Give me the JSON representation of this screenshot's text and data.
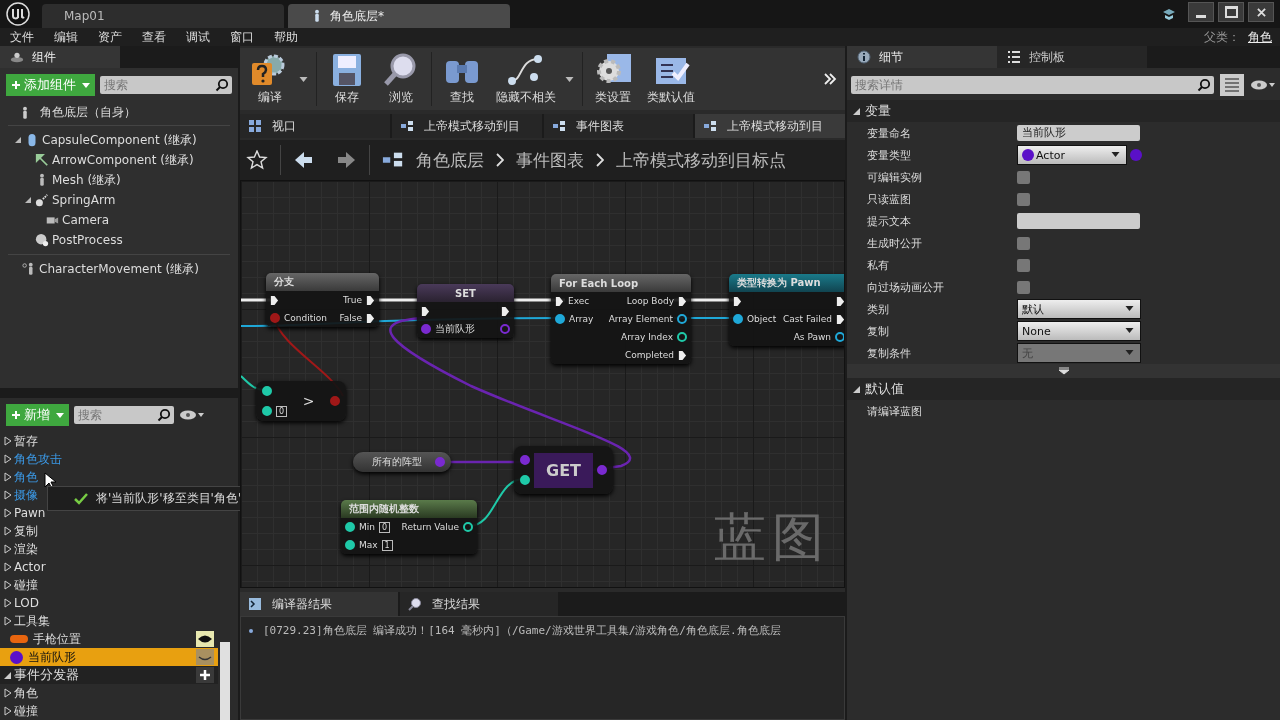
{
  "title_bar": {
    "tabs": [
      {
        "label": "Map01",
        "selected": false
      },
      {
        "label": "角色底层*",
        "selected": true
      }
    ],
    "parent_label": "父类：",
    "parent_class": "角色"
  },
  "menu": [
    "文件",
    "编辑",
    "资产",
    "查看",
    "调试",
    "窗口",
    "帮助"
  ],
  "components": {
    "tab": "组件",
    "add_button": "添加组件",
    "search": {
      "placeholder": "搜索"
    },
    "self": "角色底层（自身）",
    "tree": [
      {
        "label": "CapsuleComponent (继承)",
        "kind": "capsule",
        "expanded": true,
        "children": [
          {
            "label": "ArrowComponent (继承)",
            "kind": "arrow"
          },
          {
            "label": "Mesh (继承)",
            "kind": "mesh"
          },
          {
            "label": "SpringArm",
            "kind": "springarm",
            "expanded": true,
            "children": [
              {
                "label": "Camera",
                "kind": "camera"
              }
            ]
          },
          {
            "label": "PostProcess",
            "kind": "postprocess"
          }
        ]
      }
    ],
    "movement": "CharacterMovement (继承)"
  },
  "my_blueprint": {
    "add_button": "新增",
    "search": {
      "placeholder": "搜索"
    },
    "items": [
      {
        "kind": "category",
        "label": "暂存",
        "highlighted": false
      },
      {
        "kind": "category",
        "label": "角色攻击",
        "highlighted": true
      },
      {
        "kind": "category",
        "label": "角色",
        "highlighted": true
      },
      {
        "kind": "category",
        "label": "摄像",
        "highlighted": true
      },
      {
        "kind": "category",
        "label": "Pawn",
        "highlighted": false
      },
      {
        "kind": "category",
        "label": "复制",
        "highlighted": false
      },
      {
        "kind": "category",
        "label": "渲染",
        "highlighted": false
      },
      {
        "kind": "category",
        "label": "Actor",
        "highlighted": false
      },
      {
        "kind": "category",
        "label": "碰撞",
        "highlighted": false
      },
      {
        "kind": "category",
        "label": "LOD",
        "highlighted": false
      },
      {
        "kind": "category",
        "label": "工具集",
        "highlighted": false
      },
      {
        "kind": "variable",
        "label": "手枪位置",
        "color": "#e8650f",
        "selected": false,
        "public": true
      },
      {
        "kind": "variable",
        "label": "当前队形",
        "color": "#5a10c8",
        "selected": true,
        "public": false
      },
      {
        "kind": "section",
        "label": "事件分发器"
      },
      {
        "kind": "category",
        "label": "角色",
        "highlighted": false
      },
      {
        "kind": "category",
        "label": "碰撞",
        "highlighted": false
      }
    ],
    "tooltip": "将'当前队形'移至类目'角色'"
  },
  "toolbar": [
    {
      "label": "编译",
      "kind": "compile",
      "dropdown": true
    },
    {
      "label": "保存",
      "kind": "save",
      "dropdown": false
    },
    {
      "label": "浏览",
      "kind": "browse",
      "dropdown": false
    },
    {
      "label": "查找",
      "kind": "find",
      "dropdown": false
    },
    {
      "label": "隐藏不相关",
      "kind": "hide",
      "dropdown": true
    },
    {
      "label": "类设置",
      "kind": "settings",
      "dropdown": false
    },
    {
      "label": "类默认值",
      "kind": "defaults",
      "dropdown": false
    }
  ],
  "doc_tabs": [
    {
      "label": "视口",
      "kind": "viewport",
      "selected": false
    },
    {
      "label": "上帝模式移动到目",
      "kind": "graph",
      "selected": false
    },
    {
      "label": "事件图表",
      "kind": "graph",
      "selected": false
    },
    {
      "label": "上帝模式移动到目",
      "kind": "graph",
      "selected": true
    }
  ],
  "breadcrumb": [
    "角色底层",
    "事件图表",
    "上帝模式移动到目标点"
  ],
  "graph": {
    "watermark": "蓝图",
    "nodes": [
      {
        "kind": "branch",
        "title": "分支",
        "inputs": [
          {
            "kind": "exec"
          },
          {
            "kind": "bool",
            "label": "Condition"
          }
        ],
        "outputs": [
          {
            "kind": "exec",
            "label": "True"
          },
          {
            "kind": "exec",
            "label": "False"
          }
        ]
      },
      {
        "kind": "set",
        "title": "SET",
        "inputs": [
          {
            "kind": "exec"
          },
          {
            "kind": "actor",
            "label": "当前队形"
          }
        ],
        "outputs": [
          {
            "kind": "exec"
          },
          {
            "kind": "actor"
          }
        ]
      },
      {
        "kind": "foreach",
        "title": "For Each Loop",
        "inputs": [
          {
            "kind": "exec",
            "label": "Exec"
          },
          {
            "kind": "array",
            "label": "Array"
          }
        ],
        "outputs": [
          {
            "kind": "exec",
            "label": "Loop Body"
          },
          {
            "kind": "object",
            "label": "Array Element"
          },
          {
            "kind": "int",
            "label": "Array Index"
          },
          {
            "kind": "exec",
            "label": "Completed"
          }
        ]
      },
      {
        "kind": "cast",
        "title": "类型转换为 Pawn",
        "inputs": [
          {
            "kind": "exec"
          },
          {
            "kind": "object",
            "label": "Object"
          }
        ],
        "outputs": [
          {
            "kind": "exec"
          },
          {
            "kind": "exec",
            "label": "Cast Failed"
          },
          {
            "kind": "object",
            "label": "As Pawn"
          }
        ]
      },
      {
        "kind": "compare",
        "title": ">",
        "inputs": [
          {
            "kind": "int"
          },
          {
            "kind": "int",
            "value": "0"
          }
        ],
        "outputs": [
          {
            "kind": "bool"
          }
        ]
      },
      {
        "kind": "getvar",
        "title": "所有的阵型",
        "outputs": [
          {
            "kind": "actor"
          }
        ]
      },
      {
        "kind": "get",
        "title": "GET",
        "inputs": [
          {
            "kind": "actor"
          },
          {
            "kind": "int"
          }
        ],
        "outputs": [
          {
            "kind": "actor"
          }
        ]
      },
      {
        "kind": "func",
        "title": "范围内随机整数",
        "inputs": [
          {
            "kind": "int",
            "label": "Min",
            "value": "0"
          },
          {
            "kind": "int",
            "label": "Max",
            "value": "1"
          }
        ],
        "outputs": [
          {
            "kind": "int",
            "label": "Return Value"
          }
        ]
      }
    ]
  },
  "results": {
    "tabs": [
      {
        "label": "编译器结果",
        "kind": "compiler",
        "selected": true
      },
      {
        "label": "查找结果",
        "kind": "find",
        "selected": false
      }
    ],
    "messages": [
      "[0729.23]角色底层 编译成功！[164 毫秒内]（/Game/游戏世界工具集/游戏角色/角色底层.角色底层"
    ]
  },
  "details": {
    "tabs": [
      {
        "label": "细节",
        "kind": "details",
        "selected": true
      },
      {
        "label": "控制板",
        "kind": "palette",
        "selected": false
      }
    ],
    "search": {
      "placeholder": "搜索详情"
    },
    "sections": [
      {
        "title": "变量",
        "expanded": true,
        "has_advanced": true,
        "rows": [
          {
            "label": "变量命名",
            "kind": "text",
            "value": "当前队形"
          },
          {
            "label": "变量类型",
            "kind": "type",
            "value": "Actor"
          },
          {
            "label": "可编辑实例",
            "kind": "checkbox",
            "checked": false
          },
          {
            "label": "只读蓝图",
            "kind": "checkbox",
            "checked": false
          },
          {
            "label": "提示文本",
            "kind": "text"
          },
          {
            "label": "生成时公开",
            "kind": "checkbox",
            "checked": false
          },
          {
            "label": "私有",
            "kind": "checkbox",
            "checked": false
          },
          {
            "label": "向过场动画公开",
            "kind": "checkbox",
            "checked": false
          },
          {
            "label": "类别",
            "kind": "dropdown",
            "value": "默认",
            "disabled": false
          },
          {
            "label": "复制",
            "kind": "dropdown",
            "value": "None",
            "disabled": false
          },
          {
            "label": "复制条件",
            "kind": "dropdown",
            "value": "无",
            "disabled": true
          }
        ]
      },
      {
        "title": "默认值",
        "expanded": true,
        "has_advanced": false,
        "rows": [
          {
            "label": "请编译蓝图",
            "kind": "note"
          }
        ]
      }
    ]
  }
}
